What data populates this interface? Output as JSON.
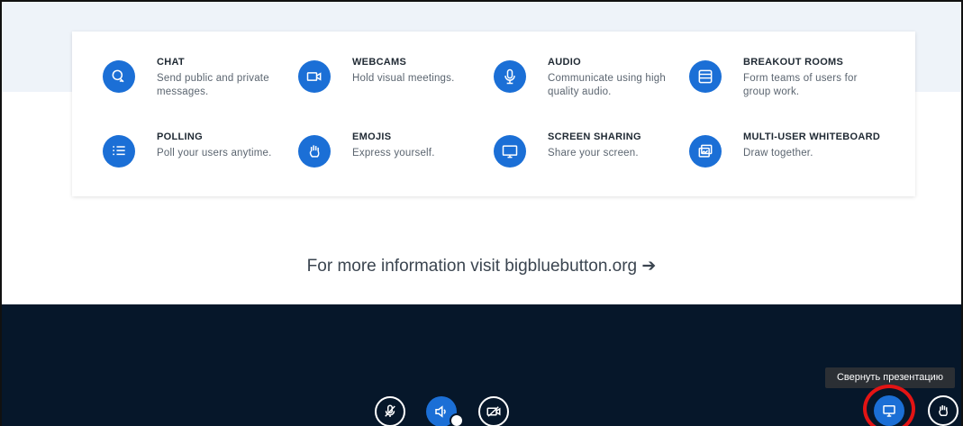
{
  "features": [
    {
      "title": "CHAT",
      "desc": "Send public and private messages.",
      "icon": "chat-icon"
    },
    {
      "title": "WEBCAMS",
      "desc": "Hold visual meetings.",
      "icon": "webcam-icon"
    },
    {
      "title": "AUDIO",
      "desc": "Communicate using high quality audio.",
      "icon": "microphone-icon"
    },
    {
      "title": "BREAKOUT ROOMS",
      "desc": "Form teams of users for group work.",
      "icon": "breakout-rooms-icon"
    },
    {
      "title": "POLLING",
      "desc": "Poll your users anytime.",
      "icon": "polling-icon"
    },
    {
      "title": "EMOJIS",
      "desc": "Express yourself.",
      "icon": "hand-icon"
    },
    {
      "title": "SCREEN SHARING",
      "desc": "Share your screen.",
      "icon": "screen-share-icon"
    },
    {
      "title": "MULTI-USER WHITEBOARD",
      "desc": "Draw together.",
      "icon": "whiteboard-icon"
    }
  ],
  "more_info": "For more information visit bigbluebutton.org ➔",
  "controls": {
    "mute_icon": "microphone-off-icon",
    "audio_icon": "speaker-icon",
    "camera_icon": "camera-off-icon",
    "presentation_icon": "presentation-icon",
    "raise_hand_icon": "hand-icon"
  },
  "tooltip": "Свернуть презентацию",
  "colors": {
    "accent": "#1b6fd6",
    "bar_bg": "#06172a",
    "highlight": "#e31414"
  }
}
